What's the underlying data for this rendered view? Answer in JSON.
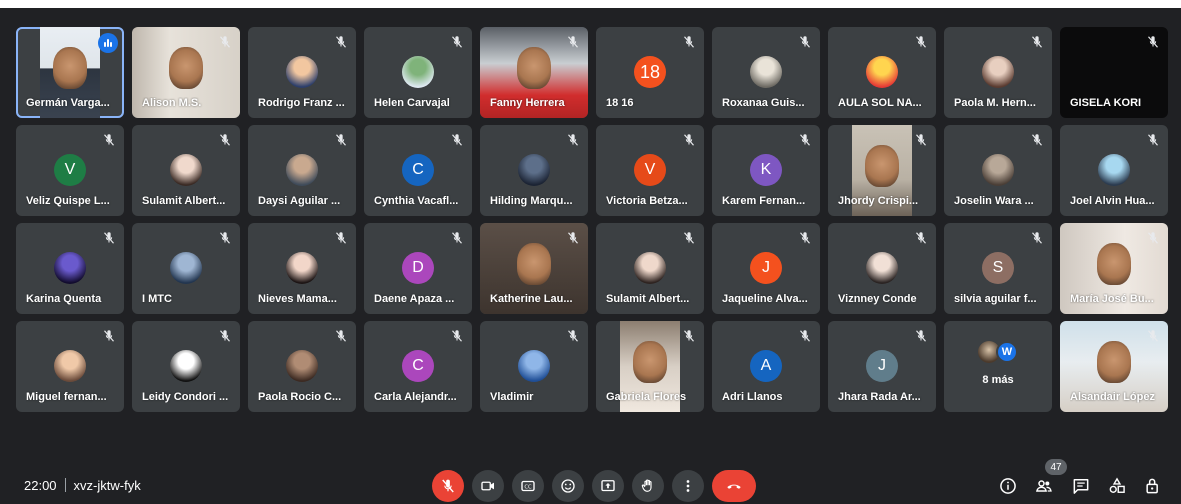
{
  "meeting": {
    "time": "22:00",
    "code": "xvz-jktw-fyk",
    "participant_count": "47"
  },
  "participants": [
    {
      "name": "Germán Varga...",
      "kind": "video",
      "speaking": true
    },
    {
      "name": "Alison M.S.",
      "kind": "video"
    },
    {
      "name": "Rodrigo Franz ...",
      "kind": "photo",
      "colors": [
        "#f2c7a0",
        "#2c3e6b"
      ]
    },
    {
      "name": "Helen Carvajal",
      "kind": "photo",
      "colors": [
        "#7fb37a",
        "#dfe9f2"
      ]
    },
    {
      "name": "Fanny Herrera",
      "kind": "video"
    },
    {
      "name": "18 16",
      "kind": "letter",
      "letter": "18",
      "color": "#f4511e"
    },
    {
      "name": "Roxanaa Guis...",
      "kind": "photo",
      "colors": [
        "#e9e3d8",
        "#6d6a63"
      ]
    },
    {
      "name": "AULA SOL NA...",
      "kind": "photo",
      "colors": [
        "#ffd54f",
        "#e53935"
      ]
    },
    {
      "name": "Paola M. Hern...",
      "kind": "photo",
      "colors": [
        "#e8cfc0",
        "#5a3b30"
      ]
    },
    {
      "name": "GISELA KORI",
      "kind": "dark"
    },
    {
      "name": "Veliz Quispe L...",
      "kind": "letter",
      "letter": "V",
      "color": "#1e7d45"
    },
    {
      "name": "Sulamit Albert...",
      "kind": "photo",
      "colors": [
        "#f0d9cc",
        "#3a2a24"
      ]
    },
    {
      "name": "Daysi Aguilar ...",
      "kind": "photo",
      "colors": [
        "#c9a98f",
        "#3f4b5a"
      ]
    },
    {
      "name": "Cynthia Vacafl...",
      "kind": "letter",
      "letter": "C",
      "color": "#1565c0"
    },
    {
      "name": "Hilding Marqu...",
      "kind": "photo",
      "colors": [
        "#5d6f8a",
        "#1b2333"
      ]
    },
    {
      "name": "Victoria Betza...",
      "kind": "letter",
      "letter": "V",
      "color": "#e64a19"
    },
    {
      "name": "Karem Fernan...",
      "kind": "letter",
      "letter": "K",
      "color": "#7e57c2"
    },
    {
      "name": "Jhordy Crispi...",
      "kind": "video"
    },
    {
      "name": "Joselin Wara ...",
      "kind": "photo",
      "colors": [
        "#b8a898",
        "#4a3e36"
      ]
    },
    {
      "name": "Joel Alvin Hua...",
      "kind": "photo",
      "colors": [
        "#a7d8f0",
        "#2b3b4f"
      ]
    },
    {
      "name": "Karina Quenta",
      "kind": "photo",
      "colors": [
        "#6a5acd",
        "#120c2e"
      ]
    },
    {
      "name": "I MTC",
      "kind": "photo",
      "colors": [
        "#9fb6d3",
        "#22354f"
      ]
    },
    {
      "name": "Nieves Mama...",
      "kind": "photo",
      "colors": [
        "#f2d6c9",
        "#1c1414"
      ]
    },
    {
      "name": "Daene Apaza ...",
      "kind": "letter",
      "letter": "D",
      "color": "#ab47bc"
    },
    {
      "name": "Katherine Lau...",
      "kind": "video"
    },
    {
      "name": "Sulamit Albert...",
      "kind": "photo",
      "colors": [
        "#efd8cb",
        "#2e2320"
      ]
    },
    {
      "name": "Jaqueline Alva...",
      "kind": "letter",
      "letter": "J",
      "color": "#f4511e"
    },
    {
      "name": "Viznney Conde",
      "kind": "photo",
      "colors": [
        "#f1e0d6",
        "#2a2322"
      ]
    },
    {
      "name": "silvia aguilar f...",
      "kind": "letter",
      "letter": "S",
      "color": "#8d6e63"
    },
    {
      "name": "María José Bu...",
      "kind": "video"
    },
    {
      "name": "Miguel fernan...",
      "kind": "photo",
      "colors": [
        "#f0c9a8",
        "#6a4a3a"
      ]
    },
    {
      "name": "Leidy Condori ...",
      "kind": "photo",
      "colors": [
        "#ffffff",
        "#111111"
      ]
    },
    {
      "name": "Paola Rocio C...",
      "kind": "photo",
      "colors": [
        "#b08c74",
        "#3c2a22"
      ]
    },
    {
      "name": "Carla Alejandr...",
      "kind": "letter",
      "letter": "C",
      "color": "#ab47bc"
    },
    {
      "name": "Vladimir",
      "kind": "photo",
      "colors": [
        "#8fb6e8",
        "#1f4e96"
      ]
    },
    {
      "name": "Gabriela Flores",
      "kind": "video"
    },
    {
      "name": "Adri Llanos",
      "kind": "letter",
      "letter": "A",
      "color": "#1565c0"
    },
    {
      "name": "Jhara Rada Ar...",
      "kind": "letter",
      "letter": "J",
      "color": "#607d8b"
    },
    {
      "name": "8 más",
      "kind": "more",
      "letter": "W"
    },
    {
      "name": "Alsandair López",
      "kind": "video"
    }
  ],
  "controls": [
    {
      "name": "mic-toggle-button",
      "icon": "mic-off-icon"
    },
    {
      "name": "camera-toggle-button",
      "icon": "camera-off-icon"
    },
    {
      "name": "captions-button",
      "icon": "captions-icon"
    },
    {
      "name": "reactions-button",
      "icon": "emoji-icon"
    },
    {
      "name": "present-button",
      "icon": "present-screen-icon"
    },
    {
      "name": "raise-hand-button",
      "icon": "hand-icon"
    },
    {
      "name": "more-options-button",
      "icon": "more-vert-icon"
    },
    {
      "name": "leave-call-button",
      "icon": "hangup-icon"
    }
  ],
  "colors": {
    "background": "#202124",
    "tile": "#3c4043",
    "danger": "#ea4335",
    "accent": "#1a73e8"
  }
}
